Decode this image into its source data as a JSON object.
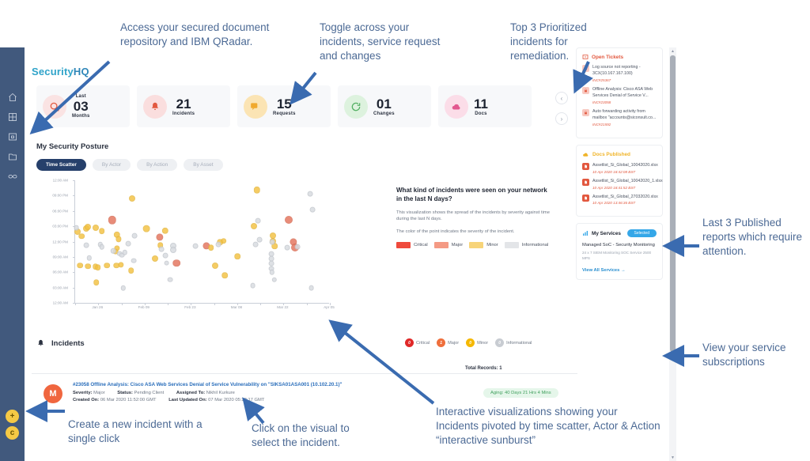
{
  "brand": {
    "part1": "Security",
    "part2": "HQ"
  },
  "sidebar": {
    "items": [
      {
        "name": "home-icon",
        "label": "Home"
      },
      {
        "name": "dashboard-icon",
        "label": "Dashboard"
      },
      {
        "name": "device-icon",
        "label": "Devices"
      },
      {
        "name": "folder-icon",
        "label": "Documents"
      },
      {
        "name": "link-icon",
        "label": "Integrations"
      }
    ],
    "fabs": [
      {
        "label": "+",
        "name": "create-incident-fab"
      },
      {
        "label": "c",
        "name": "chat-fab"
      }
    ]
  },
  "kpis": [
    {
      "top": "Last",
      "num": "03",
      "bot": "Months",
      "icon": "search-icon",
      "bubble": "#fae3e3",
      "color": "#e2583f"
    },
    {
      "top": "",
      "num": "21",
      "bot": "Incidents",
      "icon": "bell-icon",
      "bubble": "#fadede",
      "color": "#e2583f"
    },
    {
      "top": "",
      "num": "15",
      "bot": "Requests",
      "icon": "chat-icon",
      "bubble": "#fbe4b4",
      "color": "#f0a92e"
    },
    {
      "top": "",
      "num": "01",
      "bot": "Changes",
      "icon": "refresh-icon",
      "bubble": "#ddf2de",
      "color": "#53b063"
    },
    {
      "top": "",
      "num": "11",
      "bot": "Docs",
      "icon": "cloud-icon",
      "bubble": "#fbdde8",
      "color": "#e2588f"
    }
  ],
  "carousel": {
    "prev": "‹",
    "next": "›"
  },
  "posture": {
    "title": "My Security Posture",
    "tabs": [
      {
        "label": "Time Scatter",
        "selected": true
      },
      {
        "label": "By Actor",
        "selected": false
      },
      {
        "label": "By Action",
        "selected": false
      },
      {
        "label": "By Asset",
        "selected": false
      }
    ]
  },
  "chart_data": {
    "type": "scatter",
    "title": "What kind of incidents were seen on your network in the last N days?",
    "description1": "This visualization shows the spread of the incidents by severity against time during the last N days.",
    "description2": "The color of the point indicates the severity of the incident.",
    "xlabel": "",
    "ylabel": "",
    "x_ticks": [
      "Jan 26",
      "Feb 09",
      "Feb 23",
      "Mar 08",
      "Mar 22",
      "Apr 05"
    ],
    "y_ticks": [
      "12:00 AM",
      "09:00 PM",
      "06:00 PM",
      "03:00 PM",
      "12:00 PM",
      "09:00 AM",
      "06:00 AM",
      "03:00 AM",
      "12:00 AM"
    ],
    "grid": false,
    "legend_position": "right-panel",
    "legend": [
      {
        "label": "Critical",
        "color": "#ef4a3c"
      },
      {
        "label": "Major",
        "color": "#f49a84"
      },
      {
        "label": "Minor",
        "color": "#f7d479"
      },
      {
        "label": "Informational",
        "color": "#e3e5e8"
      }
    ],
    "series": [
      {
        "name": "Critical",
        "color": "#ef4a3c",
        "points": []
      },
      {
        "name": "Major",
        "color": "#e4745c",
        "points": [
          {
            "x": 14.5,
            "y": 67.5,
            "r": 4.2
          },
          {
            "x": 33.3,
            "y": 53.5,
            "r": 3.6
          },
          {
            "x": 40.0,
            "y": 32.5,
            "r": 3.8
          },
          {
            "x": 51.8,
            "y": 46.5,
            "r": 3.6
          },
          {
            "x": 84.0,
            "y": 68.0,
            "r": 4.0
          },
          {
            "x": 86.0,
            "y": 50.0,
            "r": 3.6
          },
          {
            "x": 86.5,
            "y": 45.0,
            "r": 4.0
          }
        ]
      },
      {
        "name": "Minor",
        "color": "#f3c242",
        "points": [
          {
            "x": 1.0,
            "y": 58.0,
            "r": 3.0
          },
          {
            "x": 2.5,
            "y": 54.5,
            "r": 2.8
          },
          {
            "x": 4.5,
            "y": 60.5,
            "r": 3.0
          },
          {
            "x": 2.0,
            "y": 30.5,
            "r": 2.8
          },
          {
            "x": 5.0,
            "y": 30.0,
            "r": 2.8
          },
          {
            "x": 8.0,
            "y": 29.5,
            "r": 2.8
          },
          {
            "x": 9.0,
            "y": 29.0,
            "r": 2.8
          },
          {
            "x": 8.3,
            "y": 16.5,
            "r": 2.8
          },
          {
            "x": 12.5,
            "y": 30.5,
            "r": 2.8
          },
          {
            "x": 5.0,
            "y": 62.0,
            "r": 3.0
          },
          {
            "x": 8.0,
            "y": 61.0,
            "r": 3.0
          },
          {
            "x": 10.5,
            "y": 58.5,
            "r": 2.8
          },
          {
            "x": 16.5,
            "y": 55.5,
            "r": 3.2
          },
          {
            "x": 17.0,
            "y": 52.0,
            "r": 2.6
          },
          {
            "x": 16.5,
            "y": 44.5,
            "r": 2.6
          },
          {
            "x": 16.0,
            "y": 42.0,
            "r": 2.4
          },
          {
            "x": 16.3,
            "y": 30.5,
            "r": 2.8
          },
          {
            "x": 18.0,
            "y": 31.0,
            "r": 2.6
          },
          {
            "x": 22.0,
            "y": 26.5,
            "r": 2.8
          },
          {
            "x": 22.5,
            "y": 85.0,
            "r": 3.0
          },
          {
            "x": 28.0,
            "y": 60.5,
            "r": 3.4
          },
          {
            "x": 35.5,
            "y": 59.0,
            "r": 3.2
          },
          {
            "x": 33.5,
            "y": 47.0,
            "r": 2.8
          },
          {
            "x": 31.5,
            "y": 36.0,
            "r": 3.0
          },
          {
            "x": 53.5,
            "y": 45.0,
            "r": 2.8
          },
          {
            "x": 57.0,
            "y": 49.5,
            "r": 2.8
          },
          {
            "x": 58.5,
            "y": 50.5,
            "r": 2.8
          },
          {
            "x": 55.0,
            "y": 30.5,
            "r": 3.0
          },
          {
            "x": 59.0,
            "y": 22.5,
            "r": 2.8
          },
          {
            "x": 64.0,
            "y": 38.0,
            "r": 2.8
          },
          {
            "x": 71.5,
            "y": 92.0,
            "r": 3.2
          },
          {
            "x": 70.5,
            "y": 62.5,
            "r": 3.0
          },
          {
            "x": 78.0,
            "y": 55.0,
            "r": 3.0
          },
          {
            "x": 78.0,
            "y": 50.5,
            "r": 3.0
          },
          {
            "x": 78.5,
            "y": 46.5,
            "r": 2.8
          }
        ]
      },
      {
        "name": "Informational",
        "color": "#d9dce1",
        "points": [
          {
            "x": 0.5,
            "y": 61.0,
            "r": 2.4
          },
          {
            "x": 4.5,
            "y": 47.0,
            "r": 2.4
          },
          {
            "x": 5.5,
            "y": 36.5,
            "r": 2.2
          },
          {
            "x": 10.0,
            "y": 47.5,
            "r": 2.2
          },
          {
            "x": 10.5,
            "y": 45.5,
            "r": 2.2
          },
          {
            "x": 15.0,
            "y": 42.5,
            "r": 2.2
          },
          {
            "x": 17.5,
            "y": 40.0,
            "r": 2.2
          },
          {
            "x": 18.5,
            "y": 39.0,
            "r": 2.4
          },
          {
            "x": 19.5,
            "y": 41.0,
            "r": 2.2
          },
          {
            "x": 19.0,
            "y": 12.0,
            "r": 2.2
          },
          {
            "x": 23.5,
            "y": 55.0,
            "r": 2.4
          },
          {
            "x": 23.0,
            "y": 34.5,
            "r": 2.4
          },
          {
            "x": 21.0,
            "y": 48.5,
            "r": 2.4
          },
          {
            "x": 34.0,
            "y": 44.0,
            "r": 2.4
          },
          {
            "x": 35.5,
            "y": 38.5,
            "r": 2.4
          },
          {
            "x": 36.0,
            "y": 32.5,
            "r": 2.4
          },
          {
            "x": 38.5,
            "y": 46.5,
            "r": 3.0
          },
          {
            "x": 38.5,
            "y": 43.5,
            "r": 3.0
          },
          {
            "x": 37.5,
            "y": 19.0,
            "r": 2.4
          },
          {
            "x": 47.5,
            "y": 46.5,
            "r": 2.4
          },
          {
            "x": 56.5,
            "y": 47.5,
            "r": 2.4
          },
          {
            "x": 70.0,
            "y": 14.0,
            "r": 2.4
          },
          {
            "x": 72.0,
            "y": 67.0,
            "r": 2.4
          },
          {
            "x": 72.5,
            "y": 51.5,
            "r": 2.4
          },
          {
            "x": 71.0,
            "y": 47.5,
            "r": 2.4
          },
          {
            "x": 77.5,
            "y": 49.5,
            "r": 2.4
          },
          {
            "x": 77.3,
            "y": 40.0,
            "r": 2.4
          },
          {
            "x": 77.3,
            "y": 36.0,
            "r": 2.4
          },
          {
            "x": 77.3,
            "y": 32.0,
            "r": 2.4
          },
          {
            "x": 77.3,
            "y": 28.0,
            "r": 2.4
          },
          {
            "x": 77.5,
            "y": 25.0,
            "r": 2.2
          },
          {
            "x": 78.5,
            "y": 19.0,
            "r": 2.2
          },
          {
            "x": 83.5,
            "y": 45.0,
            "r": 2.4
          },
          {
            "x": 87.5,
            "y": 45.5,
            "r": 2.4
          },
          {
            "x": 92.5,
            "y": 89.0,
            "r": 2.4
          },
          {
            "x": 93.5,
            "y": 76.0,
            "r": 2.4
          },
          {
            "x": 93.0,
            "y": 12.0,
            "r": 2.4
          }
        ]
      }
    ]
  },
  "incidents": {
    "title": "Incidents",
    "legend": [
      {
        "count": "0",
        "label": "Critical",
        "color": "#e02828"
      },
      {
        "count": "1",
        "label": "Major",
        "color": "#ef6f3c"
      },
      {
        "count": "0",
        "label": "Minor",
        "color": "#f5b800"
      },
      {
        "count": "0",
        "label": "Informational",
        "color": "#c8ccd2"
      }
    ],
    "total_records": "Total Records: 1",
    "row": {
      "avatar": "M",
      "title": "#23058 Offline Analysis: Cisco ASA Web Services Denial of Service Vulnerability on \"SIKSA01ASA001 (10.102.20.1)\"",
      "severity_label": "Severity:",
      "severity_value": "Major",
      "status_label": "Status:",
      "status_value": "Pending Client",
      "assigned_label": "Assigned To:",
      "assigned_value": "Nikhil Kurkure",
      "created_label": "Created On:",
      "created_value": "06 Mar 2020 11:52:00 GMT",
      "updated_label": "Last Updated On:",
      "updated_value": "07 Mar 2020 05:22:17 GMT",
      "aging": "Aging: 40 Days 21 Hrs 4 Mins"
    }
  },
  "right_panels": {
    "open_tickets": {
      "title": "Open Tickets",
      "items": [
        {
          "text": "Log source not reporting - 3CX(10.167.167.100)",
          "id": "INC#25367"
        },
        {
          "text": "Offline Analysis: Cisco ASA Web Services Denial of Service V...",
          "id": "INC#23058"
        },
        {
          "text": "Auto forwarding activity from mailbox \"accounts@siconsult.co...",
          "id": "INC#21592"
        }
      ]
    },
    "docs_published": {
      "title": "Docs Published",
      "items": [
        {
          "text": "Assetlist_Si_Global_10042020.xlsx",
          "date": "10 Apr 2020 18:42:08 BST"
        },
        {
          "text": "Assetlist_Si_Global_10042020_1.xlsx",
          "date": "10 Apr 2020 18:41:52 BST"
        },
        {
          "text": "Assetlist_Si_Global_27032020.xlsx",
          "date": "10 Apr 2020 13:46:36 BST"
        }
      ]
    },
    "my_services": {
      "title": "My Services",
      "badge": "Selected",
      "service_name": "Managed SoC - Security Monitoring",
      "service_desc": "24 x 7 SIEM Monitoring SOC Service 2500 MPS",
      "link": "View All Services  →"
    }
  },
  "annotations": [
    {
      "name": "annotation-document-repository",
      "text": "Access your secured document repository and IBM QRadar."
    },
    {
      "name": "annotation-toggle-incidents",
      "text": "Toggle across your incidents, service request and changes"
    },
    {
      "name": "annotation-top-incidents",
      "text": "Top 3 Prioritized incidents for remediation."
    },
    {
      "name": "annotation-published-reports",
      "text": "Last 3 Published reports which require attention."
    },
    {
      "name": "annotation-service-subscriptions",
      "text": "View your service subscriptions"
    },
    {
      "name": "annotation-create-incident",
      "text": "Create a new incident with a single click"
    },
    {
      "name": "annotation-click-visual",
      "text": "Click on the visual to select the incident."
    },
    {
      "name": "annotation-interactive-visualizations",
      "text": "Interactive visualizations showing your Incidents pivoted by time scatter, Actor & Action “interactive sunburst”"
    }
  ]
}
